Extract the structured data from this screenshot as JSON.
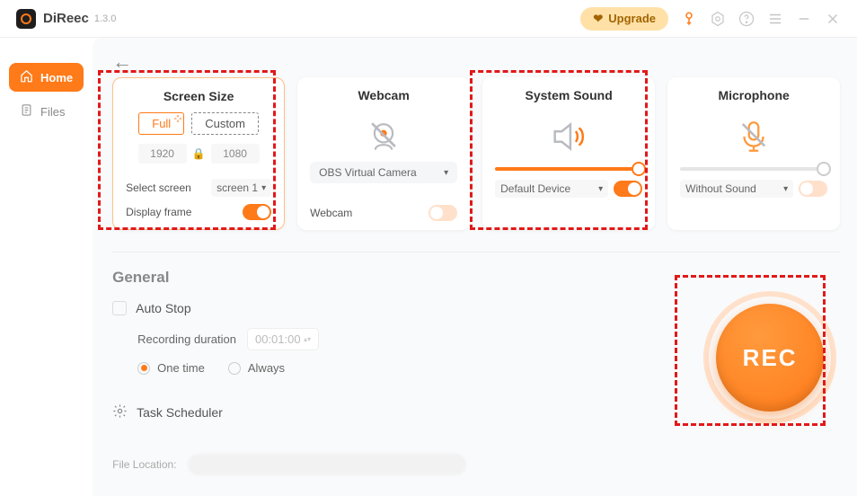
{
  "app": {
    "name": "DiReec",
    "version": "1.3.0"
  },
  "upgrade": {
    "label": "Upgrade"
  },
  "sidebar": {
    "items": [
      {
        "label": "Home"
      },
      {
        "label": "Files"
      }
    ]
  },
  "cards": {
    "screen": {
      "title": "Screen Size",
      "mode_full": "Full",
      "mode_custom": "Custom",
      "width": "1920",
      "height": "1080",
      "select_label": "Select screen",
      "select_value": "screen 1",
      "display_frame_label": "Display frame"
    },
    "webcam": {
      "title": "Webcam",
      "device": "OBS Virtual Camera",
      "toggle_label": "Webcam"
    },
    "system_sound": {
      "title": "System Sound",
      "device": "Default Device"
    },
    "mic": {
      "title": "Microphone",
      "device": "Without Sound"
    }
  },
  "general": {
    "heading": "General",
    "auto_stop": "Auto Stop",
    "duration_label": "Recording duration",
    "duration_value": "00:01:00",
    "one_time": "One time",
    "always": "Always",
    "task_scheduler": "Task Scheduler",
    "file_location_label": "File Location:"
  },
  "rec": {
    "label": "REC"
  },
  "colors": {
    "accent": "#ff7a18",
    "highlight": "#e11919"
  }
}
